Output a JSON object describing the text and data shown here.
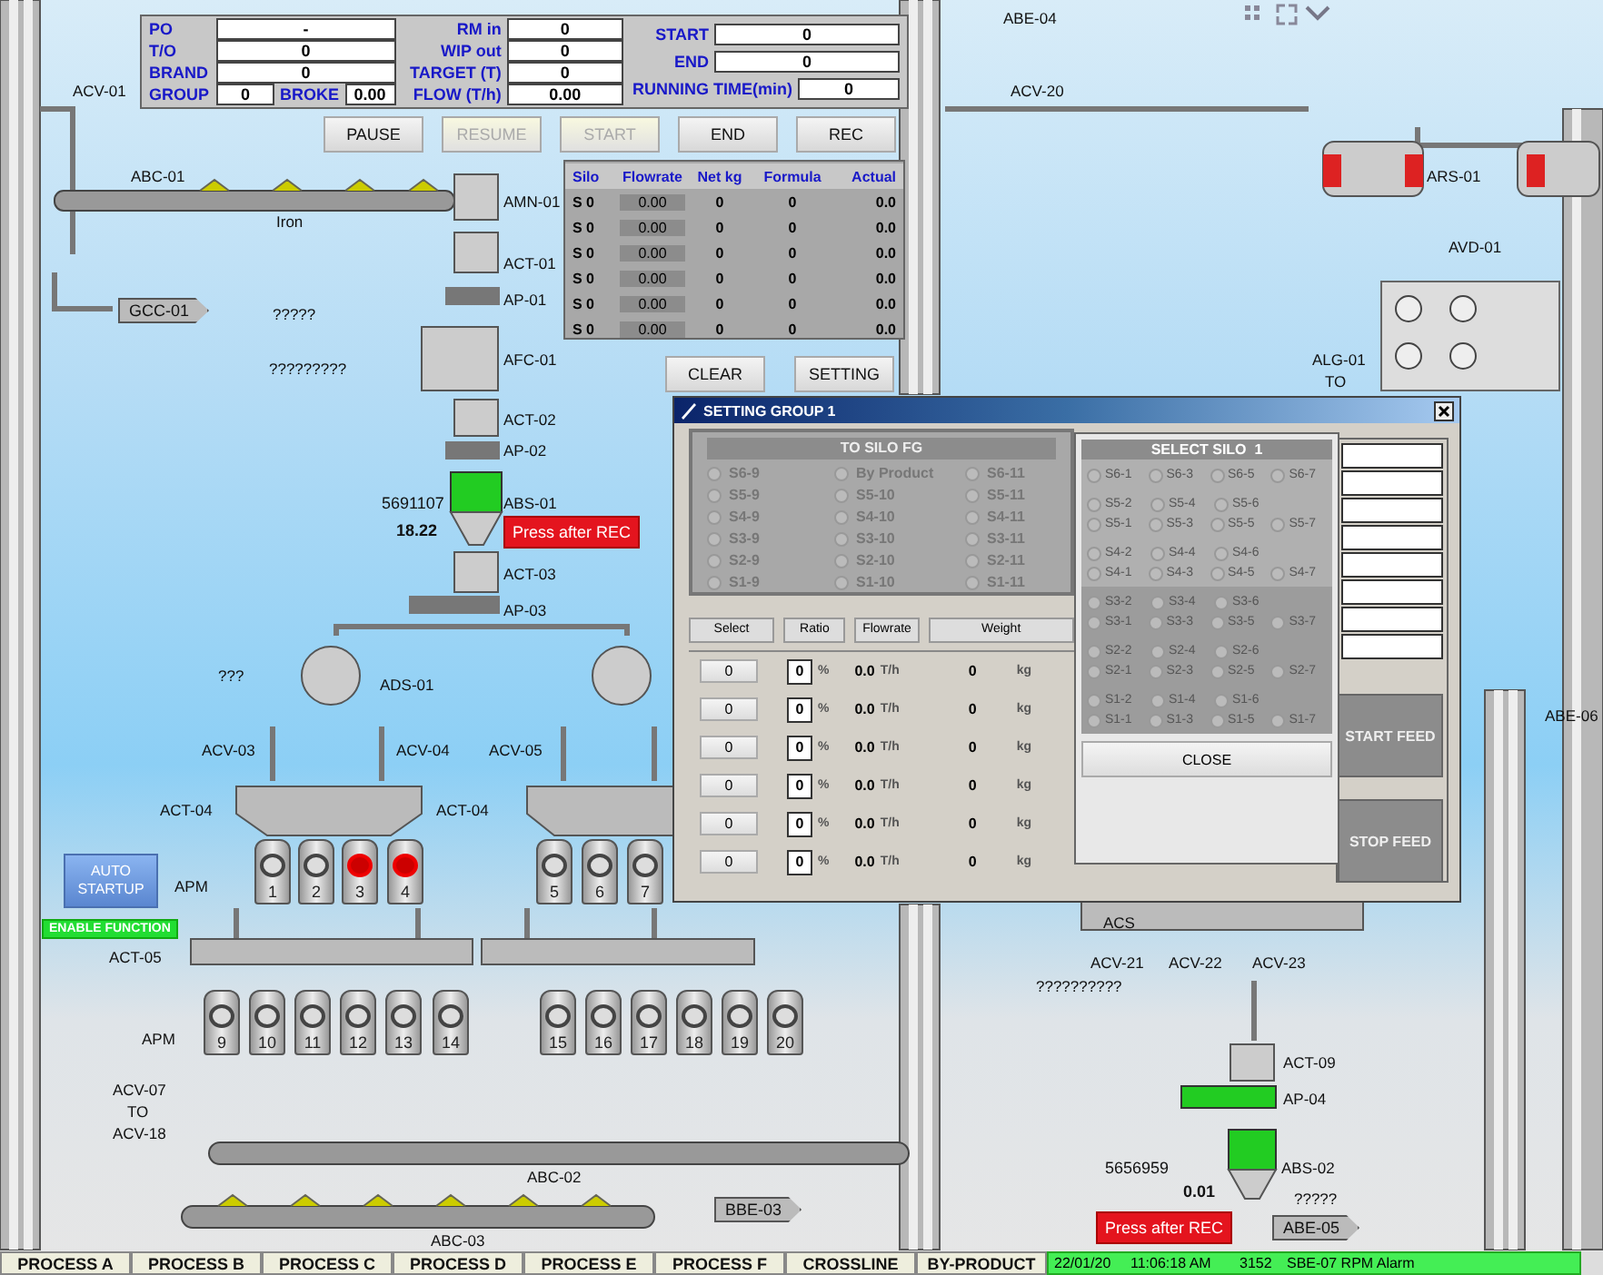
{
  "info_panel": {
    "col1": [
      {
        "label": "PO",
        "value": "-"
      },
      {
        "label": "T/O",
        "value": "0"
      },
      {
        "label": "BRAND",
        "value": "0"
      }
    ],
    "group": {
      "label": "GROUP",
      "value": "0"
    },
    "broke": {
      "label": "BROKE",
      "value": "0.00"
    },
    "col2": [
      {
        "label": "RM in",
        "value": "0"
      },
      {
        "label": "WIP out",
        "value": "0"
      },
      {
        "label": "TARGET (T)",
        "value": "0"
      },
      {
        "label": "FLOW (T/h)",
        "value": "0.00"
      }
    ],
    "col3": [
      {
        "label": "START",
        "value": "0"
      },
      {
        "label": "END",
        "value": "0"
      },
      {
        "label": "RUNNING TIME(min)",
        "value": "0"
      }
    ]
  },
  "control_buttons": [
    {
      "label": "PAUSE",
      "disabled": false
    },
    {
      "label": "RESUME",
      "disabled": true
    },
    {
      "label": "START",
      "disabled": true
    },
    {
      "label": "END",
      "disabled": false
    },
    {
      "label": "REC",
      "disabled": false
    }
  ],
  "silo_table": {
    "columns": [
      "Silo",
      "Flowrate",
      "Net kg",
      "Formula",
      "Actual"
    ],
    "rows": [
      {
        "silo": "S 0",
        "flowrate": "0.00",
        "net": "0",
        "formula": "0",
        "actual": "0.0"
      },
      {
        "silo": "S 0",
        "flowrate": "0.00",
        "net": "0",
        "formula": "0",
        "actual": "0.0"
      },
      {
        "silo": "S 0",
        "flowrate": "0.00",
        "net": "0",
        "formula": "0",
        "actual": "0.0"
      },
      {
        "silo": "S 0",
        "flowrate": "0.00",
        "net": "0",
        "formula": "0",
        "actual": "0.0"
      },
      {
        "silo": "S 0",
        "flowrate": "0.00",
        "net": "0",
        "formula": "0",
        "actual": "0.0"
      },
      {
        "silo": "S 0",
        "flowrate": "0.00",
        "net": "0",
        "formula": "0",
        "actual": "0.0"
      }
    ]
  },
  "table_buttons": [
    "CLEAR",
    "SETTING"
  ],
  "diagram_labels": [
    "ACV-01",
    "ABC-01",
    "Iron",
    "?????",
    "?????????",
    "AMN-01",
    "ACT-01",
    "AP-01",
    "AFC-01",
    "ACT-02",
    "AP-02",
    "ABS-01",
    "ACT-03",
    "AP-03",
    "???",
    "ADS-01",
    "ACV-03",
    "ACV-04",
    "ACV-05",
    "ACT-04",
    "ACT-04",
    "APM",
    "ACT-05",
    "APM",
    "ACV-07",
    "TO",
    "ACV-18",
    "ABC-02",
    "ABC-03",
    "ABE-04",
    "ACV-20",
    "ARS-01",
    "AVD-01",
    "ALG-01",
    "TO",
    "ABE-06",
    "ACS",
    "ACV-21",
    "ACV-22",
    "ACV-23",
    "??????????",
    "ACT-09",
    "AP-04",
    "ABS-02",
    "?????"
  ],
  "readings": [
    {
      "text": "5691107",
      "kind": "total"
    },
    {
      "text": "18.22",
      "kind": "rate"
    },
    {
      "text": "5656959",
      "kind": "total"
    },
    {
      "text": "0.01",
      "kind": "rate"
    }
  ],
  "rec_buttons": [
    "Press after REC",
    "Press after REC"
  ],
  "tags": [
    "GCC-01",
    "BBE-03",
    "ABE-05"
  ],
  "auto_startup": "AUTO STARTUP",
  "enable_function": "ENABLE FUNCTION",
  "silo_units": [
    {
      "number": "1",
      "alarm": false
    },
    {
      "number": "2",
      "alarm": false
    },
    {
      "number": "3",
      "alarm": true
    },
    {
      "number": "4",
      "alarm": true
    },
    {
      "number": "5",
      "alarm": false
    },
    {
      "number": "6",
      "alarm": false
    },
    {
      "number": "7",
      "alarm": false
    },
    {
      "number": "9",
      "alarm": false
    },
    {
      "number": "10",
      "alarm": false
    },
    {
      "number": "11",
      "alarm": false
    },
    {
      "number": "12",
      "alarm": false
    },
    {
      "number": "13",
      "alarm": false
    },
    {
      "number": "14",
      "alarm": false
    },
    {
      "number": "15",
      "alarm": false
    },
    {
      "number": "16",
      "alarm": false
    },
    {
      "number": "17",
      "alarm": false
    },
    {
      "number": "18",
      "alarm": false
    },
    {
      "number": "19",
      "alarm": false
    },
    {
      "number": "20",
      "alarm": false
    }
  ],
  "dialog": {
    "title": "SETTING GROUP 1",
    "fg_title": "TO SILO FG",
    "fg_options": [
      {
        "label": "S6-9",
        "selected": false
      },
      {
        "label": "By Product",
        "selected": false
      },
      {
        "label": "S6-11",
        "selected": false
      },
      {
        "label": "S5-9",
        "selected": false
      },
      {
        "label": "S5-10",
        "selected": false
      },
      {
        "label": "S5-11",
        "selected": false
      },
      {
        "label": "S4-9",
        "selected": false
      },
      {
        "label": "S4-10",
        "selected": false
      },
      {
        "label": "S4-11",
        "selected": false
      },
      {
        "label": "S3-9",
        "selected": false
      },
      {
        "label": "S3-10",
        "selected": false
      },
      {
        "label": "S3-11",
        "selected": false
      },
      {
        "label": "S2-9",
        "selected": false
      },
      {
        "label": "S2-10",
        "selected": false
      },
      {
        "label": "S2-11",
        "selected": false
      },
      {
        "label": "S1-9",
        "selected": false
      },
      {
        "label": "S1-10",
        "selected": false
      },
      {
        "label": "S1-11",
        "selected": false
      }
    ],
    "columns": [
      "Select",
      "Ratio",
      "Flowrate",
      "Weight"
    ],
    "rows": [
      {
        "select": "0",
        "ratio": "0",
        "ratio_unit": "%",
        "flowrate": "0.0",
        "flow_unit": "T/h",
        "weight": "0",
        "weight_unit": "kg"
      },
      {
        "select": "0",
        "ratio": "0",
        "ratio_unit": "%",
        "flowrate": "0.0",
        "flow_unit": "T/h",
        "weight": "0",
        "weight_unit": "kg"
      },
      {
        "select": "0",
        "ratio": "0",
        "ratio_unit": "%",
        "flowrate": "0.0",
        "flow_unit": "T/h",
        "weight": "0",
        "weight_unit": "kg"
      },
      {
        "select": "0",
        "ratio": "0",
        "ratio_unit": "%",
        "flowrate": "0.0",
        "flow_unit": "T/h",
        "weight": "0",
        "weight_unit": "kg"
      },
      {
        "select": "0",
        "ratio": "0",
        "ratio_unit": "%",
        "flowrate": "0.0",
        "flow_unit": "T/h",
        "weight": "0",
        "weight_unit": "kg"
      },
      {
        "select": "0",
        "ratio": "0",
        "ratio_unit": "%",
        "flowrate": "0.0",
        "flow_unit": "T/h",
        "weight": "0",
        "weight_unit": "kg"
      }
    ],
    "feed_buttons": [
      "START FEED",
      "STOP FEED"
    ],
    "select_silo": {
      "title": "SELECT SILO",
      "number": "1",
      "groups": [
        {
          "rows": [
            [
              {
                "label": "S6-1",
                "selected": false
              },
              {
                "label": "S6-3",
                "selected": false
              },
              {
                "label": "S6-5",
                "selected": false
              },
              {
                "label": "S6-7",
                "selected": false
              }
            ]
          ]
        },
        {
          "rows": [
            [
              {
                "label": "S5-2",
                "selected": false
              },
              {
                "label": "S5-4",
                "selected": false
              },
              {
                "label": "S5-6",
                "selected": false
              }
            ],
            [
              {
                "label": "S5-1",
                "selected": false
              },
              {
                "label": "S5-3",
                "selected": false
              },
              {
                "label": "S5-5",
                "selected": false
              },
              {
                "label": "S5-7",
                "selected": false
              }
            ]
          ]
        },
        {
          "rows": [
            [
              {
                "label": "S4-2",
                "selected": false
              },
              {
                "label": "S4-4",
                "selected": false
              },
              {
                "label": "S4-6",
                "selected": false
              }
            ],
            [
              {
                "label": "S4-1",
                "selected": false
              },
              {
                "label": "S4-3",
                "selected": false
              },
              {
                "label": "S4-5",
                "selected": false
              },
              {
                "label": "S4-7",
                "selected": false
              }
            ]
          ]
        },
        {
          "rows": [
            [
              {
                "label": "S3-2",
                "selected": false
              },
              {
                "label": "S3-4",
                "selected": false
              },
              {
                "label": "S3-6",
                "selected": false
              }
            ],
            [
              {
                "label": "S3-1",
                "selected": false
              },
              {
                "label": "S3-3",
                "selected": false
              },
              {
                "label": "S3-5",
                "selected": false
              },
              {
                "label": "S3-7",
                "selected": false
              }
            ]
          ]
        },
        {
          "rows": [
            [
              {
                "label": "S2-2",
                "selected": false
              },
              {
                "label": "S2-4",
                "selected": false
              },
              {
                "label": "S2-6",
                "selected": false
              }
            ],
            [
              {
                "label": "S2-1",
                "selected": false
              },
              {
                "label": "S2-3",
                "selected": false
              },
              {
                "label": "S2-5",
                "selected": false
              },
              {
                "label": "S2-7",
                "selected": false
              }
            ]
          ]
        },
        {
          "rows": [
            [
              {
                "label": "S1-2",
                "selected": false
              },
              {
                "label": "S1-4",
                "selected": false
              },
              {
                "label": "S1-6",
                "selected": false
              }
            ],
            [
              {
                "label": "S1-1",
                "selected": false
              },
              {
                "label": "S1-3",
                "selected": false
              },
              {
                "label": "S1-5",
                "selected": false
              },
              {
                "label": "S1-7",
                "selected": false
              }
            ]
          ]
        }
      ],
      "close": "CLOSE"
    }
  },
  "process_tabs": [
    "PROCESS A",
    "PROCESS B",
    "PROCESS C",
    "PROCESS D",
    "PROCESS E",
    "PROCESS F",
    "CROSSLINE",
    "BY-PRODUCT"
  ],
  "status_bar": {
    "date": "22/01/20",
    "time": "11:06:18 AM",
    "code": "3152",
    "message": "SBE-07 RPM Alarm"
  }
}
